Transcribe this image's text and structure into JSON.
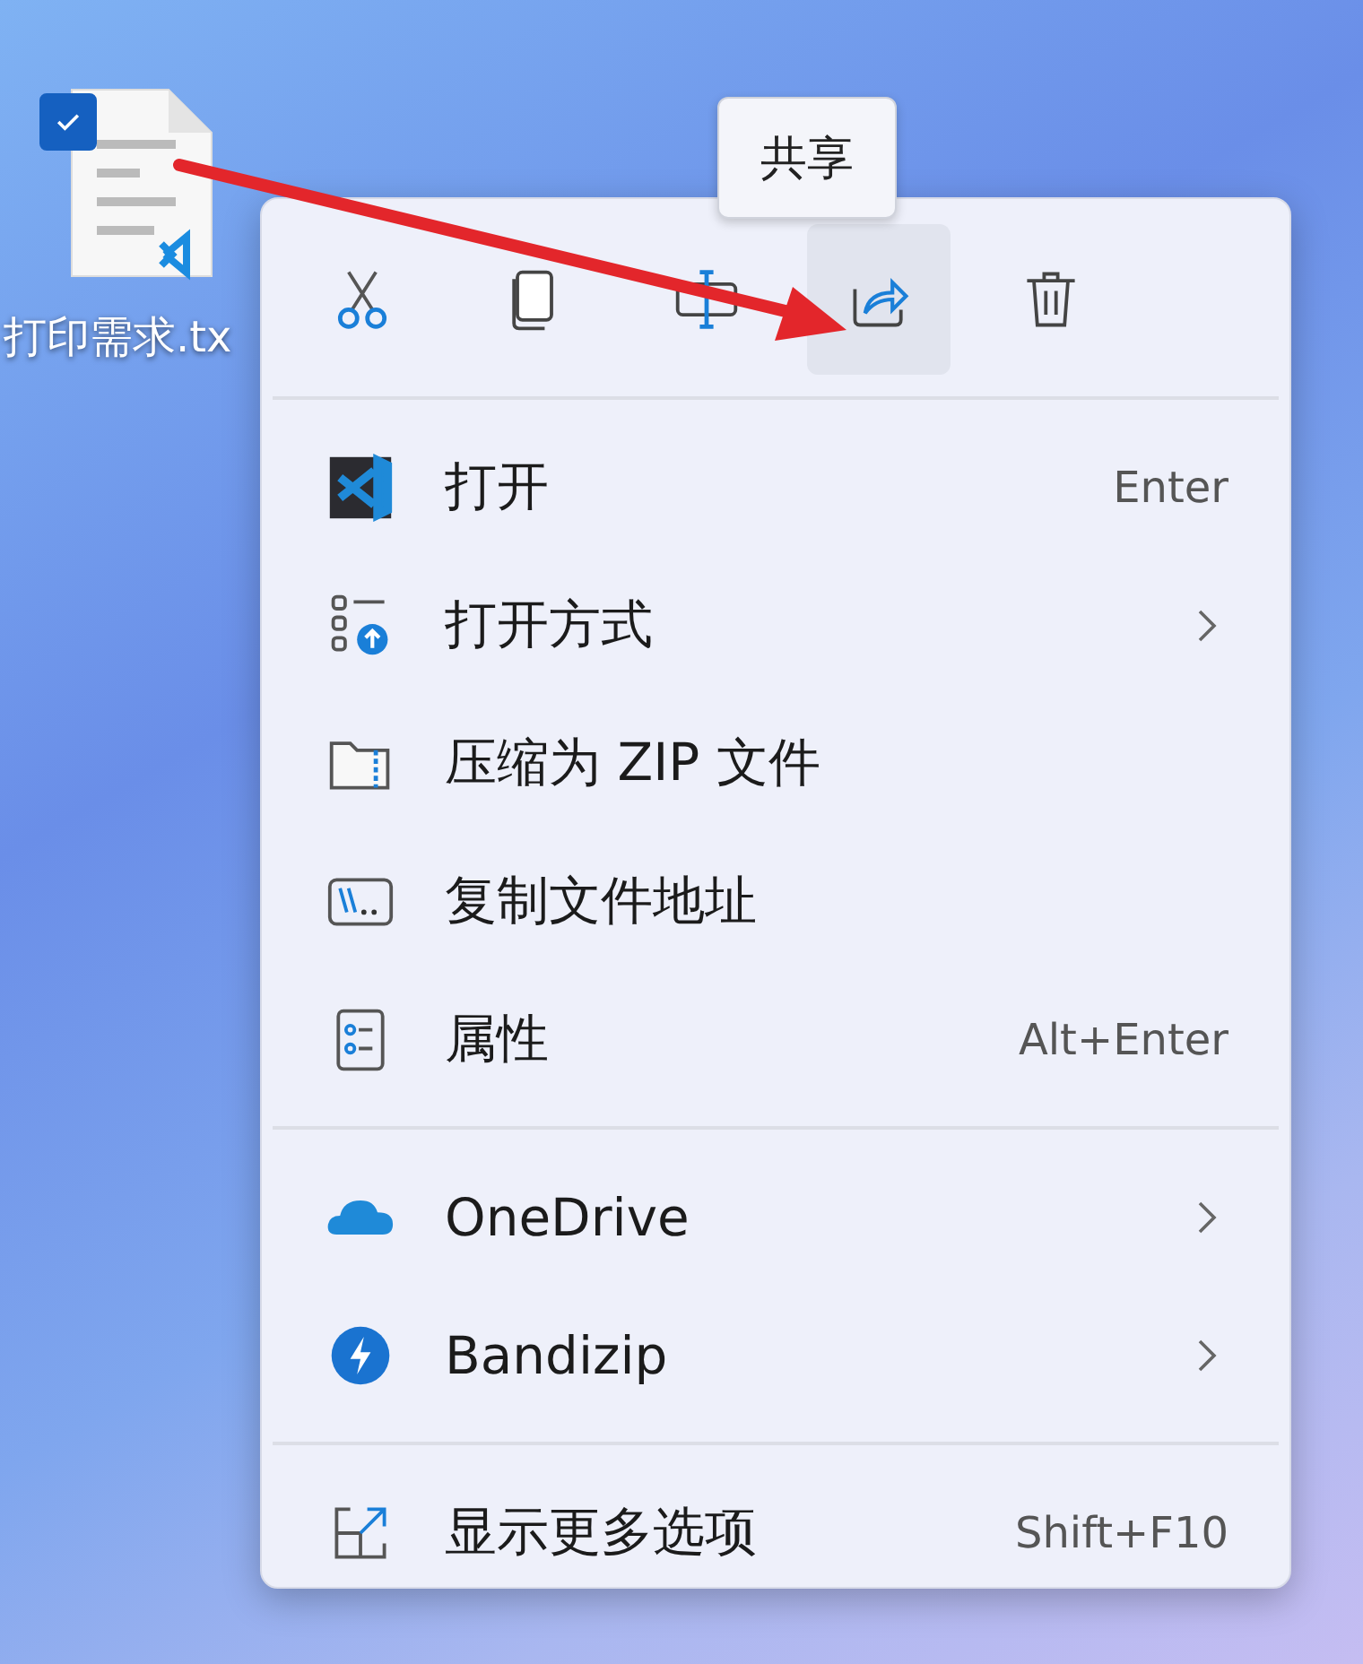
{
  "desktop_icon": {
    "label": "打印需求.tx",
    "checked": true
  },
  "tooltip": {
    "text": "共享"
  },
  "context_menu": {
    "toolbar": [
      {
        "hovered": false
      },
      {
        "hovered": false
      },
      {
        "hovered": false
      },
      {
        "hovered": true
      },
      {
        "hovered": false
      }
    ],
    "sections": [
      [
        {
          "label": "打开",
          "shortcut": "Enter",
          "submenu": false
        },
        {
          "label": "打开方式",
          "submenu": true
        },
        {
          "label": "压缩为 ZIP 文件",
          "submenu": false
        },
        {
          "label": "复制文件地址",
          "submenu": false
        },
        {
          "label": "属性",
          "shortcut": "Alt+Enter",
          "submenu": false
        }
      ],
      [
        {
          "label": "OneDrive",
          "submenu": true
        },
        {
          "label": "Bandizip",
          "submenu": true
        }
      ],
      [
        {
          "label": "显示更多选项",
          "shortcut": "Shift+F10",
          "submenu": false
        }
      ]
    ]
  }
}
